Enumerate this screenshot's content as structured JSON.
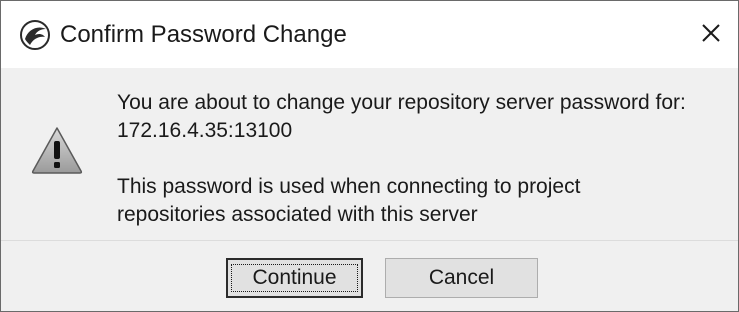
{
  "dialog": {
    "title": "Confirm Password Change",
    "close_label": "✕",
    "message_line1": "You are about to change your repository server password for:",
    "message_line2": "172.16.4.35:13100",
    "message_line3": "This password is used when connecting to project",
    "message_line4": "repositories associated with this server",
    "icons": {
      "app": "app-logo-icon",
      "warning": "warning-icon",
      "close": "close-icon"
    }
  },
  "buttons": {
    "continue_label": "Continue",
    "cancel_label": "Cancel",
    "default": "continue"
  },
  "colors": {
    "titlebar_bg": "#ffffff",
    "dialog_bg": "#f0f0f0",
    "button_bg": "#e1e1e1",
    "text": "#1a1a1a"
  }
}
